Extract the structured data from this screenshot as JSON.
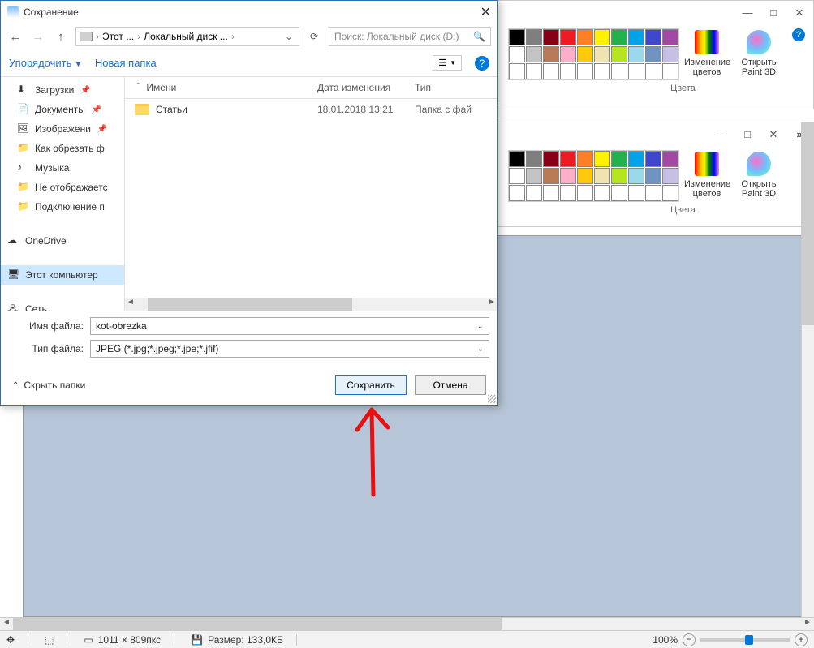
{
  "paint": {
    "ribbon_group_label": "Цвета",
    "change_colors_label": "Изменение цветов",
    "open_paint3d_label": "Открыть Paint 3D",
    "palette_row1": [
      "#000000",
      "#7f7f7f",
      "#880015",
      "#ed1c24",
      "#ff7f27",
      "#fff200",
      "#22b14c",
      "#00a2e8",
      "#3f48cc",
      "#a349a4"
    ],
    "palette_row2": [
      "#ffffff",
      "#c3c3c3",
      "#b97a57",
      "#ffaec9",
      "#ffc90e",
      "#efe4b0",
      "#b5e61d",
      "#99d9ea",
      "#7092be",
      "#c8bfe7"
    ],
    "palette_row3": [
      "",
      "",
      "",
      "",
      "",
      "",
      "",
      "",
      "",
      ""
    ]
  },
  "statusbar": {
    "dims": "1011 × 809пкс",
    "size": "Размер: 133,0КБ",
    "zoom": "100%"
  },
  "dialog": {
    "title": "Сохранение",
    "breadcrumb": {
      "root": "Этот ...",
      "current": "Локальный диск ..."
    },
    "search_placeholder": "Поиск: Локальный диск (D:)",
    "toolbar": {
      "organize": "Упорядочить",
      "new_folder": "Новая папка"
    },
    "sidebar": [
      {
        "label": "Загрузки",
        "pinned": true,
        "icon": "download"
      },
      {
        "label": "Документы",
        "pinned": true,
        "icon": "doc"
      },
      {
        "label": "Изображени",
        "pinned": true,
        "icon": "image"
      },
      {
        "label": "Как обрезать ф",
        "icon": "folder"
      },
      {
        "label": "Музыка",
        "icon": "music"
      },
      {
        "label": "Не отображаетс",
        "icon": "folder"
      },
      {
        "label": "Подключение п",
        "icon": "folder"
      },
      {
        "label": "OneDrive",
        "root": true,
        "icon": "onedrive"
      },
      {
        "label": "Этот компьютер",
        "root": true,
        "selected": true,
        "icon": "pc"
      },
      {
        "label": "Сеть",
        "root": true,
        "icon": "network"
      }
    ],
    "file_headers": {
      "name": "Имени",
      "date": "Дата изменения",
      "type": "Тип"
    },
    "files": [
      {
        "name": "Статьи",
        "date": "18.01.2018 13:21",
        "type": "Папка с фай"
      }
    ],
    "fields": {
      "filename_label": "Имя файла:",
      "filename_value": "kot-obrezka",
      "filetype_label": "Тип файла:",
      "filetype_value": "JPEG (*.jpg;*.jpeg;*.jpe;*.jfif)"
    },
    "hide_folders": "Скрыть папки",
    "buttons": {
      "save": "Сохранить",
      "cancel": "Отмена"
    }
  }
}
